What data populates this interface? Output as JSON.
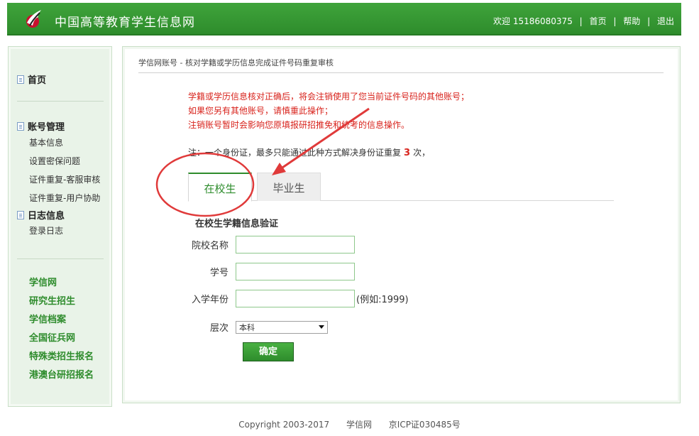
{
  "header": {
    "site_title": "中国高等教育学生信息网",
    "welcome": "欢迎 15186080375",
    "links": [
      "首页",
      "帮助",
      "退出"
    ],
    "separator": "|"
  },
  "sidebar": {
    "home": "首页",
    "account_section": "账号管理",
    "account_items": [
      "基本信息",
      "设置密保问题",
      "证件重复-客服审核",
      "证件重复-用户协助"
    ],
    "log_section": "日志信息",
    "log_items": [
      "登录日志"
    ],
    "external_links": [
      "学信网",
      "研究生招生",
      "学信档案",
      "全国征兵网",
      "特殊类招生报名",
      "港澳台研招报名"
    ]
  },
  "main": {
    "breadcrumb": "学信网账号 - 核对学籍或学历信息完成证件号码重复审核",
    "warnings": [
      "学籍或学历信息核对正确后，将会注销使用了您当前证件号码的其他账号；",
      "如果您另有其他账号，请慎重此操作；",
      "注销账号暂时会影响您原填报研招推免和统考的信息操作。"
    ],
    "note_prefix": "注：一个身份证，最多只能通过此种方式解决身份证重复",
    "note_count": "3",
    "note_suffix": "次，",
    "tabs": [
      {
        "label": "在校生",
        "active": true
      },
      {
        "label": "毕业生",
        "active": false
      }
    ],
    "form": {
      "title": "在校生学籍信息验证",
      "school_label": "院校名称",
      "school_value": "",
      "student_id_label": "学号",
      "student_id_value": "",
      "year_label": "入学年份",
      "year_value": "",
      "year_hint": "(例如:1999)",
      "level_label": "层次",
      "level_selected": "本科",
      "submit_label": "确定"
    }
  },
  "footer": {
    "copyright": "Copyright 2003-2017",
    "site": "学信网",
    "icp": "京ICP证030485号"
  },
  "colors": {
    "brand_green": "#2e8c2c",
    "warning_red": "#d8231c",
    "annotation_red": "#e03a3a"
  },
  "icons": {
    "logo": "running-horse-logo",
    "doc": "document-icon",
    "select_arrow": "chevron-down-icon"
  }
}
